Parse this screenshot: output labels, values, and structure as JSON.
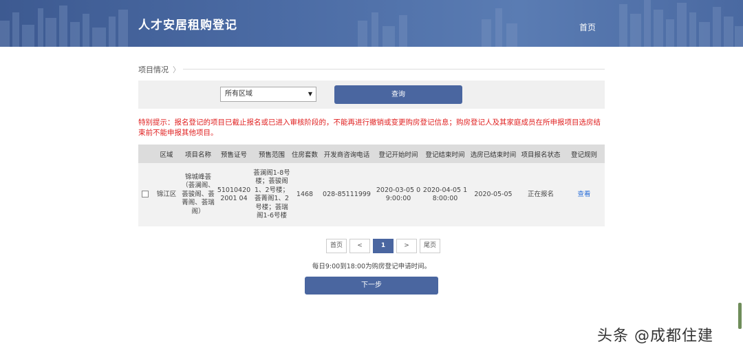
{
  "header": {
    "site_title": "人才安居租购登记",
    "nav_home": "首页"
  },
  "breadcrumb": {
    "label": "项目情况",
    "chevron": "〉"
  },
  "filter": {
    "region_selected": "所有区域",
    "query_label": "查询"
  },
  "notice": "特别提示：报名登记的项目已截止报名或已进入审核阶段的，不能再进行撤销或变更购房登记信息；购房登记人及其家庭成员在所申报项目选房结束前不能申报其他项目。",
  "table": {
    "headers": [
      "区域",
      "项目名称",
      "预售证号",
      "预售范围",
      "住房套数",
      "开发商咨询电话",
      "登记开始时间",
      "登记结束时间",
      "选房已结束时间",
      "项目报名状态",
      "登记规则"
    ],
    "rows": [
      {
        "region": "锦江区",
        "project_name": "锦城峰荟（荟澜阁、荟骏阁、荟菁阁、荟瑞阁）",
        "presale_no": "510104202001 04",
        "presale_scope": "荟澜阁1-8号楼；荟骏阁1、2号楼；荟菁阁1、2号楼；荟瑞阁1-6号楼",
        "units": "1468",
        "phone": "028-85111999",
        "reg_start": "2020-03-05 09:00:00",
        "reg_end": "2020-04-05 18:00:00",
        "selection_end": "2020-05-05",
        "status": "正在报名",
        "rule_link": "查看"
      }
    ]
  },
  "pagination": {
    "first": "首页",
    "prev": "<",
    "current": "1",
    "next": ">",
    "last": "尾页"
  },
  "hours_note": "每日9:00到18:00为购房登记申请时间。",
  "next_button": "下一步",
  "watermark": "头条 @成都住建",
  "colors": {
    "header_bg": "#4a6aa3",
    "primary_button": "#4a66a0",
    "notice_text": "#e02020",
    "link": "#2a6fd8"
  }
}
